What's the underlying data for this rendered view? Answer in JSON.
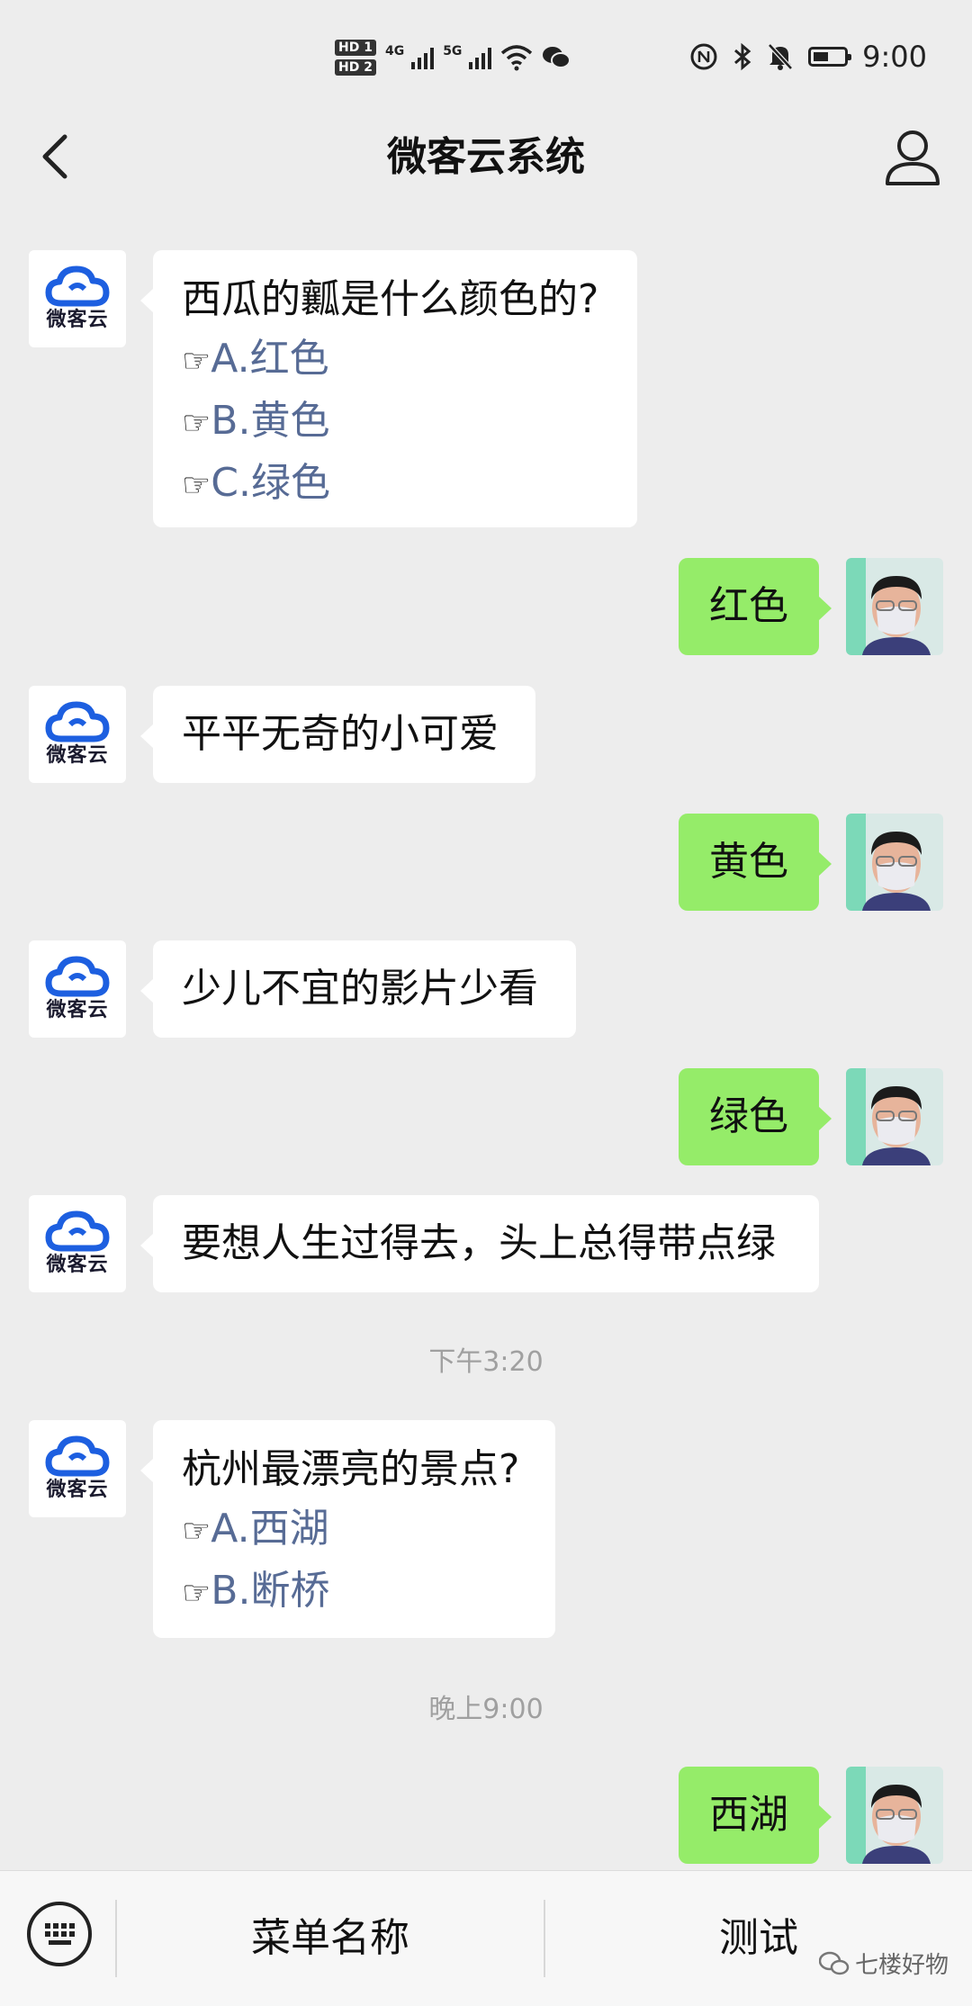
{
  "status_bar": {
    "hd1": "HD 1",
    "hd2": "HD 2",
    "net1": "4G",
    "net2": "5G",
    "time": "9:00"
  },
  "header": {
    "title": "微客云系统"
  },
  "bot": {
    "logo_text": "微客云"
  },
  "messages": [
    {
      "side": "left",
      "question": "西瓜的瓤是什么颜色的?",
      "options": [
        "A.红色",
        "B.黄色",
        "C.绿色"
      ]
    },
    {
      "side": "right",
      "text": "红色"
    },
    {
      "side": "left",
      "text": "平平无奇的小可爱"
    },
    {
      "side": "right",
      "text": "黄色"
    },
    {
      "side": "left",
      "text": "少儿不宜的影片少看"
    },
    {
      "side": "right",
      "text": "绿色"
    },
    {
      "side": "left",
      "text": "要想人生过得去，头上总得带点绿"
    },
    {
      "side": "time",
      "text": "下午3:20"
    },
    {
      "side": "left",
      "question": "杭州最漂亮的景点?",
      "options": [
        "A.西湖",
        "B.断桥"
      ]
    },
    {
      "side": "time",
      "text": "晚上9:00"
    },
    {
      "side": "right",
      "text": "西湖"
    }
  ],
  "option_marker": "☞",
  "bottom_bar": {
    "menu1": "菜单名称",
    "menu2": "测试",
    "watermark": "七楼好物"
  },
  "colors": {
    "background": "#ededed",
    "sent_bubble": "#95ec69",
    "option_link": "#576b95",
    "logo_blue": "#1d5fe0"
  },
  "icons": {
    "back": "chevron-left-icon",
    "profile": "user-icon",
    "keyboard": "keyboard-icon"
  }
}
